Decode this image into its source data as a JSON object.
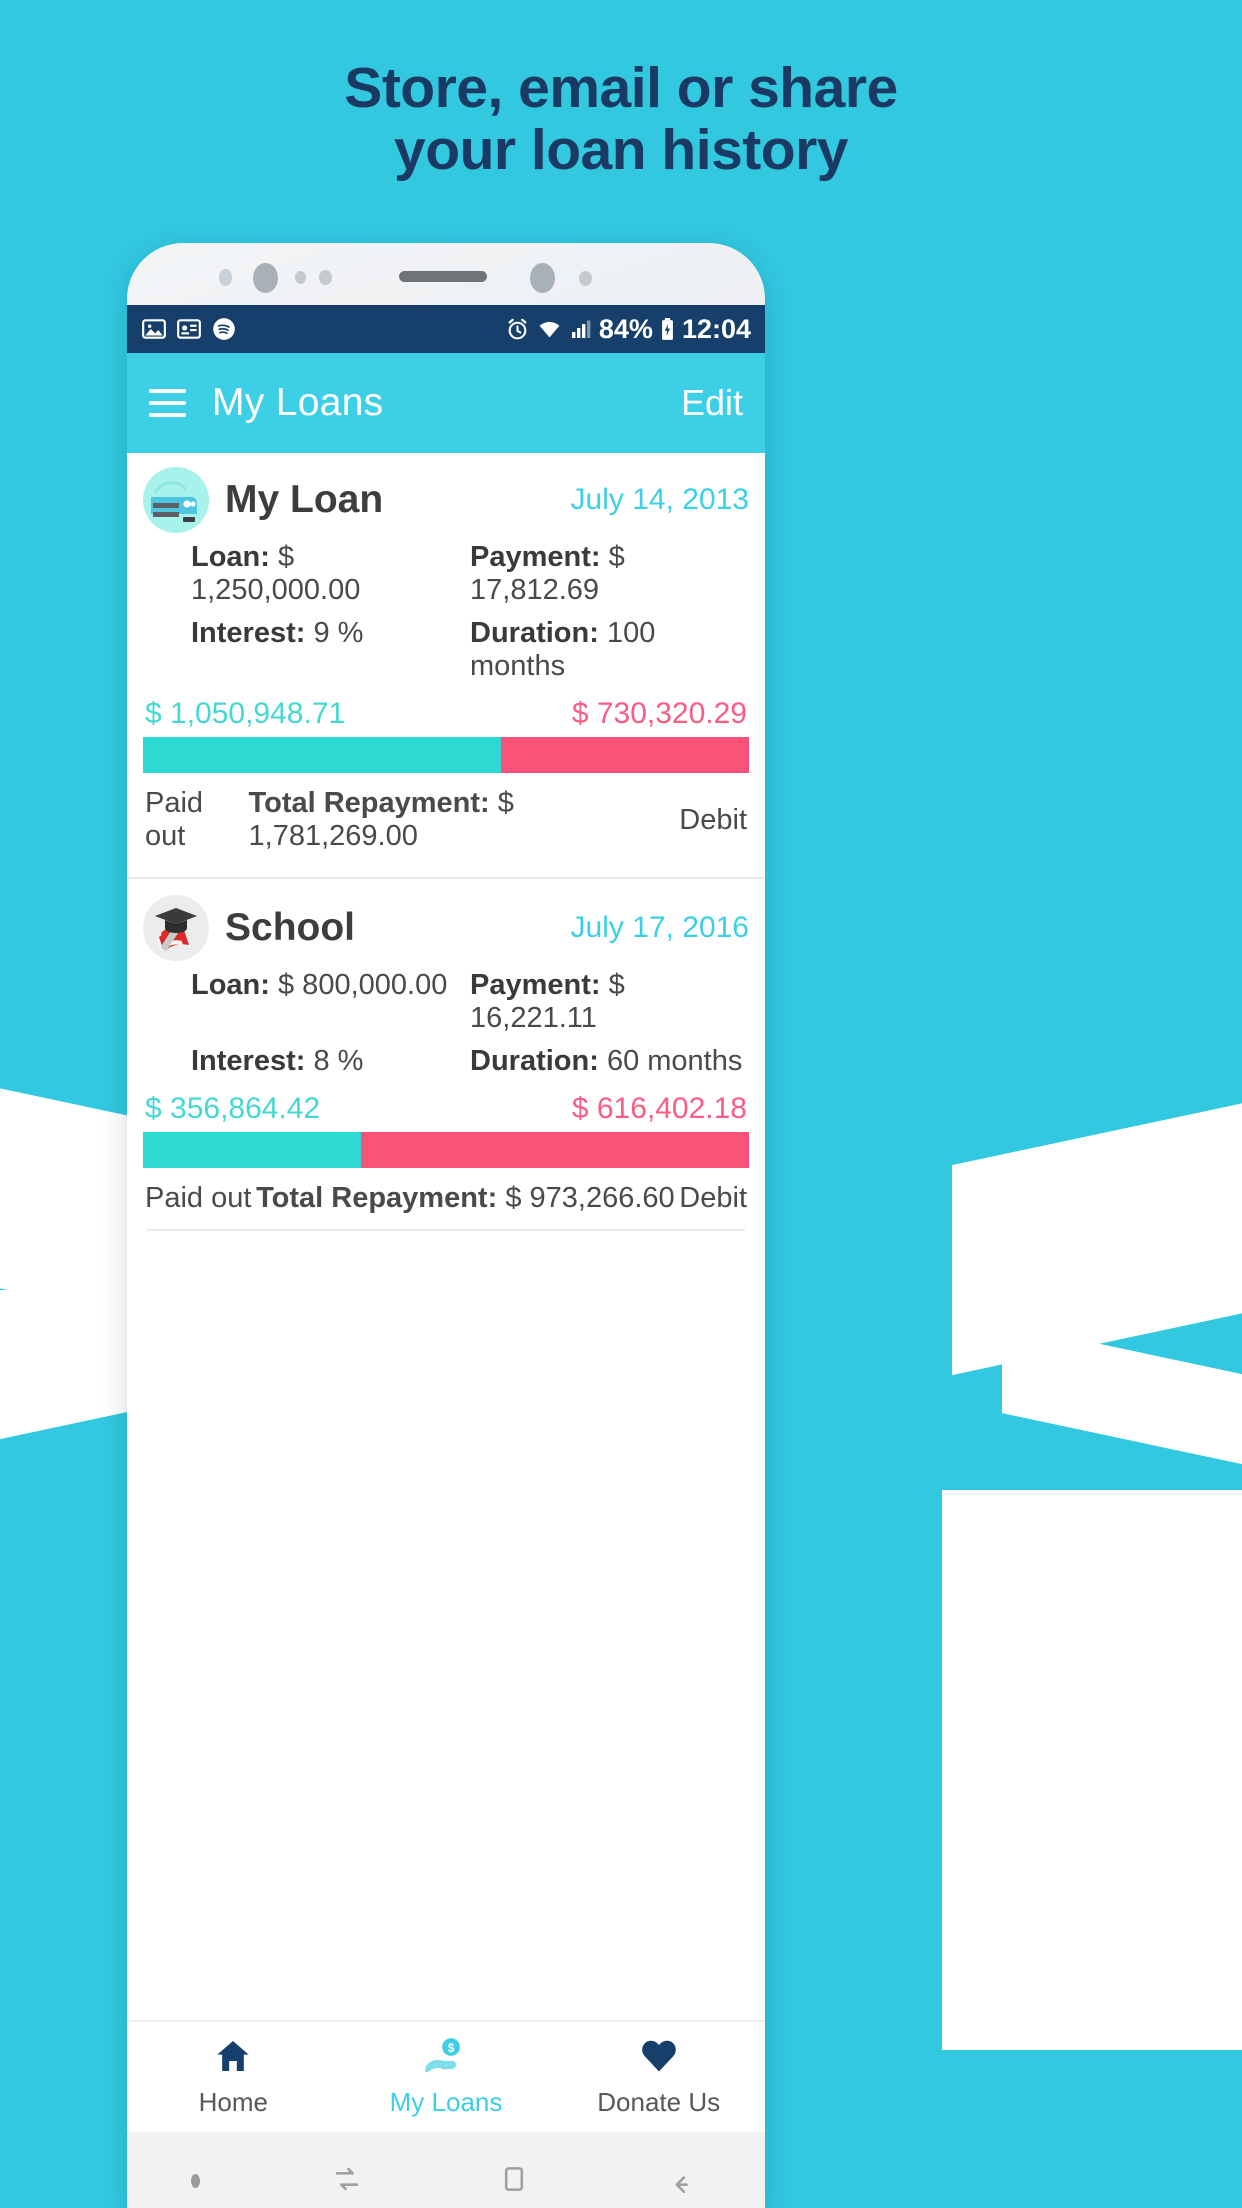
{
  "promo": {
    "headline_line1": "Store, email or share",
    "headline_line2": "your loan history",
    "bg_color": "#32c8e0",
    "headline_color": "#1b3a63"
  },
  "statusbar": {
    "left_icons": [
      "photo-icon",
      "contact-card-icon",
      "spotify-icon"
    ],
    "alarm_icon": "alarm-icon",
    "wifi_icon": "wifi-icon",
    "signal_icon": "signal-icon",
    "battery_percent": "84%",
    "battery_icon": "battery-charging-icon",
    "time": "12:04"
  },
  "appbar": {
    "menu_icon": "hamburger-menu-icon",
    "title": "My Loans",
    "action_label": "Edit",
    "accent": "#3dcfe6"
  },
  "loans": [
    {
      "icon": "car-icon",
      "name": "My Loan",
      "date": "July 14, 2013",
      "loan_label": "Loan:",
      "loan_value": "$ 1,250,000.00",
      "payment_label": "Payment:",
      "payment_value": "$ 17,812.69",
      "interest_label": "Interest:",
      "interest_value": "9 %",
      "duration_label": "Duration:",
      "duration_value": "100 months",
      "paid_amount": "$ 1,050,948.71",
      "debit_amount": "$ 730,320.29",
      "progress_percent": 59,
      "paid_label": "Paid out",
      "total_label": "Total Repayment:",
      "total_value": "$ 1,781,269.00",
      "debit_label": "Debit"
    },
    {
      "icon": "graduation-cap-icon",
      "name": "School",
      "date": "July 17, 2016",
      "loan_label": "Loan:",
      "loan_value": "$ 800,000.00",
      "payment_label": "Payment:",
      "payment_value": "$ 16,221.11",
      "interest_label": "Interest:",
      "interest_value": "8 %",
      "duration_label": "Duration:",
      "duration_value": "60 months",
      "paid_amount": "$ 356,864.42",
      "debit_amount": "$ 616,402.18",
      "progress_percent": 36,
      "paid_label": "Paid out",
      "total_label": "Total Repayment:",
      "total_value": "$ 973,266.60",
      "debit_label": "Debit"
    }
  ],
  "colors": {
    "paid_teal": "#2ed9d4",
    "debit_pink": "#fb5279",
    "date_cyan": "#3dcfe6",
    "navy": "#16406b"
  },
  "bottom_nav": {
    "items": [
      {
        "icon": "home-icon",
        "label": "Home",
        "active": false
      },
      {
        "icon": "hand-coin-icon",
        "label": "My Loans",
        "active": true
      },
      {
        "icon": "heart-icon",
        "label": "Donate Us",
        "active": false
      }
    ]
  },
  "android_nav": {
    "items": [
      "menu-dot-icon",
      "recents-icon",
      "home-square-icon",
      "back-arrow-icon"
    ]
  }
}
